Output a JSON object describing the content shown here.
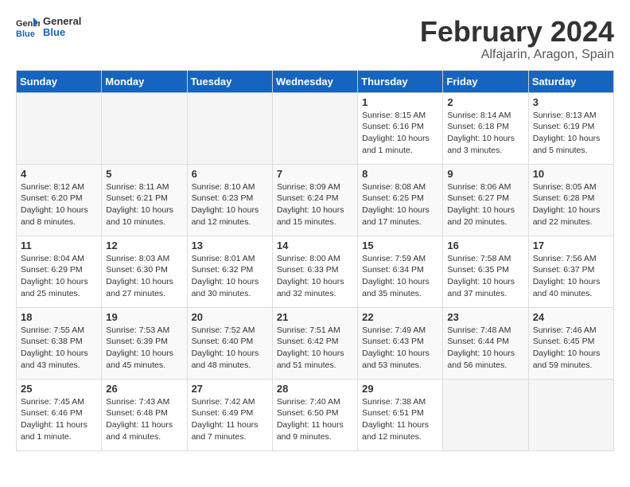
{
  "header": {
    "logo_general": "General",
    "logo_blue": "Blue",
    "title": "February 2024",
    "subtitle": "Alfajarin, Aragon, Spain"
  },
  "weekdays": [
    "Sunday",
    "Monday",
    "Tuesday",
    "Wednesday",
    "Thursday",
    "Friday",
    "Saturday"
  ],
  "weeks": [
    [
      {
        "day": "",
        "info": ""
      },
      {
        "day": "",
        "info": ""
      },
      {
        "day": "",
        "info": ""
      },
      {
        "day": "",
        "info": ""
      },
      {
        "day": "1",
        "info": "Sunrise: 8:15 AM\nSunset: 6:16 PM\nDaylight: 10 hours\nand 1 minute."
      },
      {
        "day": "2",
        "info": "Sunrise: 8:14 AM\nSunset: 6:18 PM\nDaylight: 10 hours\nand 3 minutes."
      },
      {
        "day": "3",
        "info": "Sunrise: 8:13 AM\nSunset: 6:19 PM\nDaylight: 10 hours\nand 5 minutes."
      }
    ],
    [
      {
        "day": "4",
        "info": "Sunrise: 8:12 AM\nSunset: 6:20 PM\nDaylight: 10 hours\nand 8 minutes."
      },
      {
        "day": "5",
        "info": "Sunrise: 8:11 AM\nSunset: 6:21 PM\nDaylight: 10 hours\nand 10 minutes."
      },
      {
        "day": "6",
        "info": "Sunrise: 8:10 AM\nSunset: 6:23 PM\nDaylight: 10 hours\nand 12 minutes."
      },
      {
        "day": "7",
        "info": "Sunrise: 8:09 AM\nSunset: 6:24 PM\nDaylight: 10 hours\nand 15 minutes."
      },
      {
        "day": "8",
        "info": "Sunrise: 8:08 AM\nSunset: 6:25 PM\nDaylight: 10 hours\nand 17 minutes."
      },
      {
        "day": "9",
        "info": "Sunrise: 8:06 AM\nSunset: 6:27 PM\nDaylight: 10 hours\nand 20 minutes."
      },
      {
        "day": "10",
        "info": "Sunrise: 8:05 AM\nSunset: 6:28 PM\nDaylight: 10 hours\nand 22 minutes."
      }
    ],
    [
      {
        "day": "11",
        "info": "Sunrise: 8:04 AM\nSunset: 6:29 PM\nDaylight: 10 hours\nand 25 minutes."
      },
      {
        "day": "12",
        "info": "Sunrise: 8:03 AM\nSunset: 6:30 PM\nDaylight: 10 hours\nand 27 minutes."
      },
      {
        "day": "13",
        "info": "Sunrise: 8:01 AM\nSunset: 6:32 PM\nDaylight: 10 hours\nand 30 minutes."
      },
      {
        "day": "14",
        "info": "Sunrise: 8:00 AM\nSunset: 6:33 PM\nDaylight: 10 hours\nand 32 minutes."
      },
      {
        "day": "15",
        "info": "Sunrise: 7:59 AM\nSunset: 6:34 PM\nDaylight: 10 hours\nand 35 minutes."
      },
      {
        "day": "16",
        "info": "Sunrise: 7:58 AM\nSunset: 6:35 PM\nDaylight: 10 hours\nand 37 minutes."
      },
      {
        "day": "17",
        "info": "Sunrise: 7:56 AM\nSunset: 6:37 PM\nDaylight: 10 hours\nand 40 minutes."
      }
    ],
    [
      {
        "day": "18",
        "info": "Sunrise: 7:55 AM\nSunset: 6:38 PM\nDaylight: 10 hours\nand 43 minutes."
      },
      {
        "day": "19",
        "info": "Sunrise: 7:53 AM\nSunset: 6:39 PM\nDaylight: 10 hours\nand 45 minutes."
      },
      {
        "day": "20",
        "info": "Sunrise: 7:52 AM\nSunset: 6:40 PM\nDaylight: 10 hours\nand 48 minutes."
      },
      {
        "day": "21",
        "info": "Sunrise: 7:51 AM\nSunset: 6:42 PM\nDaylight: 10 hours\nand 51 minutes."
      },
      {
        "day": "22",
        "info": "Sunrise: 7:49 AM\nSunset: 6:43 PM\nDaylight: 10 hours\nand 53 minutes."
      },
      {
        "day": "23",
        "info": "Sunrise: 7:48 AM\nSunset: 6:44 PM\nDaylight: 10 hours\nand 56 minutes."
      },
      {
        "day": "24",
        "info": "Sunrise: 7:46 AM\nSunset: 6:45 PM\nDaylight: 10 hours\nand 59 minutes."
      }
    ],
    [
      {
        "day": "25",
        "info": "Sunrise: 7:45 AM\nSunset: 6:46 PM\nDaylight: 11 hours\nand 1 minute."
      },
      {
        "day": "26",
        "info": "Sunrise: 7:43 AM\nSunset: 6:48 PM\nDaylight: 11 hours\nand 4 minutes."
      },
      {
        "day": "27",
        "info": "Sunrise: 7:42 AM\nSunset: 6:49 PM\nDaylight: 11 hours\nand 7 minutes."
      },
      {
        "day": "28",
        "info": "Sunrise: 7:40 AM\nSunset: 6:50 PM\nDaylight: 11 hours\nand 9 minutes."
      },
      {
        "day": "29",
        "info": "Sunrise: 7:38 AM\nSunset: 6:51 PM\nDaylight: 11 hours\nand 12 minutes."
      },
      {
        "day": "",
        "info": ""
      },
      {
        "day": "",
        "info": ""
      }
    ]
  ]
}
